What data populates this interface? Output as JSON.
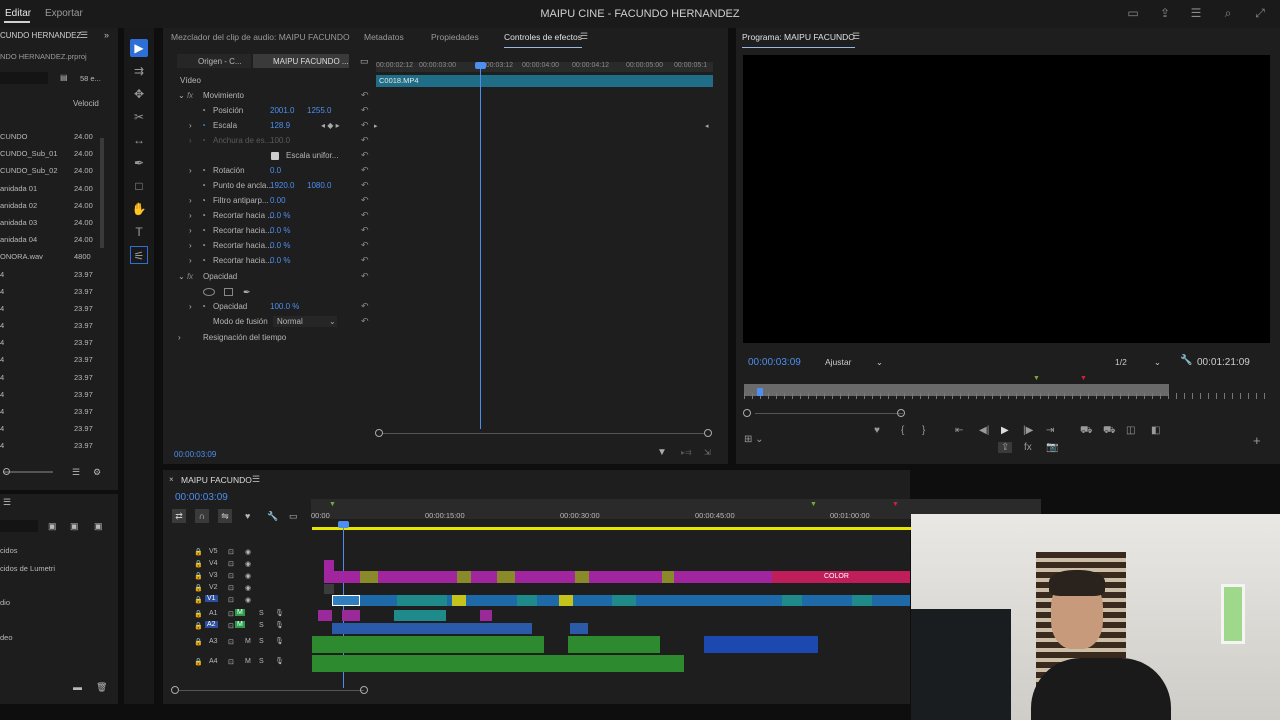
{
  "menu": {
    "edit": "Editar",
    "export": "Exportar"
  },
  "app_title": "MAIPU CINE - FACUNDO HERNANDEZ",
  "project": {
    "tab": "CUNDO HERNANDEZ",
    "file": "NDO HERNANDEZ.prproj",
    "count": "58 e...",
    "col_header": "Velocid",
    "items": [
      {
        "name": "CUNDO",
        "rate": "24.00"
      },
      {
        "name": "CUNDO_Sub_01",
        "rate": "24.00"
      },
      {
        "name": "CUNDO_Sub_02",
        "rate": "24.00"
      },
      {
        "name": "anidada 01",
        "rate": "24.00"
      },
      {
        "name": "anidada 02",
        "rate": "24.00"
      },
      {
        "name": "anidada 03",
        "rate": "24.00"
      },
      {
        "name": "anidada 04",
        "rate": "24.00"
      },
      {
        "name": "ONORA.wav",
        "rate": "4800"
      },
      {
        "name": "4",
        "rate": "23.97"
      },
      {
        "name": "4",
        "rate": "23.97"
      },
      {
        "name": "4",
        "rate": "23.97"
      },
      {
        "name": "4",
        "rate": "23.97"
      },
      {
        "name": "4",
        "rate": "23.97"
      },
      {
        "name": "4",
        "rate": "23.97"
      },
      {
        "name": "4",
        "rate": "23.97"
      },
      {
        "name": "4",
        "rate": "23.97"
      },
      {
        "name": "4",
        "rate": "23.97"
      },
      {
        "name": "4",
        "rate": "23.97"
      },
      {
        "name": "4",
        "rate": "23.97"
      }
    ]
  },
  "effects_panel": {
    "items": [
      "cidos",
      "cidos de Lumetri",
      "dio",
      "deo"
    ]
  },
  "panel_tabs": {
    "audio_mixer": "Mezclador del clip de audio: MAIPU FACUNDO",
    "metadata": "Metadatos",
    "properties": "Propiedades",
    "effect_controls": "Controles de efectos"
  },
  "effect_controls": {
    "source": "Origen - C...",
    "sequence": "MAIPU FACUNDO ...",
    "clip": "C0018.MP4",
    "ruler": [
      "00:00:02:12",
      "00:00:03:00",
      "00:00:03:12",
      "00:00:04:00",
      "00:00:04:12",
      "00:00:05:00",
      "00:00:05:1"
    ],
    "video_label": "Vídeo",
    "motion": "Movimiento",
    "position": {
      "label": "Posición",
      "x": "2001.0",
      "y": "1255.0"
    },
    "scale": {
      "label": "Escala",
      "v": "128.9"
    },
    "scale_width": {
      "label": "Anchura de es...",
      "v": "100.0"
    },
    "uniform": "Escala unifor...",
    "rotation": {
      "label": "Rotación",
      "v": "0.0"
    },
    "anchor": {
      "label": "Punto de ancla...",
      "x": "1920.0",
      "y": "1080.0"
    },
    "antiflicker": {
      "label": "Filtro antiparp...",
      "v": "0.00"
    },
    "crop1": {
      "label": "Recortar hacia ...",
      "v": "0.0 %"
    },
    "crop2": {
      "label": "Recortar hacia...",
      "v": "0.0 %"
    },
    "crop3": {
      "label": "Recortar hacia...",
      "v": "0.0 %"
    },
    "crop4": {
      "label": "Recortar hacia...",
      "v": "0.0 %"
    },
    "opacity_group": "Opacidad",
    "opacity": {
      "label": "Opacidad",
      "v": "100.0 %"
    },
    "blend": {
      "label": "Modo de fusión",
      "v": "Normal"
    },
    "time_remap": "Resignación del tiempo",
    "timecode": "00:00:03:09"
  },
  "program": {
    "title": "Programa: MAIPU FACUNDO",
    "timecode": "00:00:03:09",
    "fit": "Ajustar",
    "res": "1/2",
    "duration": "00:01:21:09"
  },
  "timeline": {
    "name": "MAIPU FACUNDO",
    "timecode": "00:00:03:09",
    "ruler": [
      "00:00",
      "00:00:15:00",
      "00:00:30:00",
      "00:00:45:00",
      "00:01:00:00"
    ],
    "tracks": [
      "V5",
      "V4",
      "V3",
      "V2",
      "V1",
      "A1",
      "A2",
      "A3",
      "A4"
    ],
    "color_label": "COLOR"
  },
  "colors": {
    "accent": "#2d6fd6",
    "timecode": "#4d8ff0",
    "purple": "#a0259f",
    "magenta": "#c01e8c",
    "v1": "#1e6aa8",
    "teal": "#1f8a8a",
    "audio": "#2a8a2a",
    "blueaudio": "#1c49b0"
  }
}
